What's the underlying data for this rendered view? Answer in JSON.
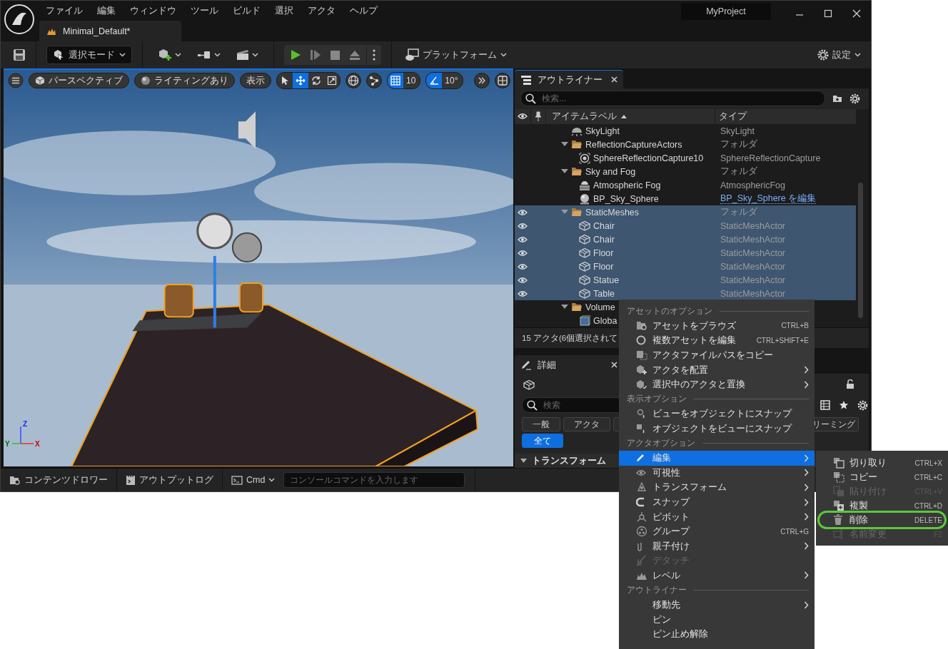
{
  "window": {
    "title": "MyProject",
    "menu": [
      "ファイル",
      "編集",
      "ウィンドウ",
      "ツール",
      "ビルド",
      "選択",
      "アクタ",
      "ヘルプ"
    ],
    "tab": "Minimal_Default*"
  },
  "toolbar": {
    "mode": "選択モード",
    "platform": "プラットフォーム",
    "settings": "設定"
  },
  "viewport": {
    "view": "パースペクティブ",
    "lighting": "ライティングあり",
    "show": "表示",
    "tools": [
      {
        "selected": false
      },
      {
        "selected": true
      },
      {
        "selected": false
      },
      {
        "selected": false
      }
    ],
    "grid": {
      "on": true,
      "value": "10"
    },
    "angle": {
      "on": true,
      "value": "10°"
    },
    "axes": [
      "Z",
      "Y",
      "X"
    ]
  },
  "outliner": {
    "title": "アウトライナー",
    "search": {
      "placeholder": "検索..."
    },
    "columns": [
      "アイテムラベル",
      "タイプ"
    ],
    "rows": [
      {
        "label": "SkyLight",
        "kind": "light",
        "type": "SkyLight",
        "type_link": false,
        "selected": false
      },
      {
        "label": "ReflectionCaptureActors",
        "kind": "folder",
        "expanded": true,
        "type": "フォルダ",
        "type_link": false,
        "selected": false,
        "children": [
          {
            "label": "SphereReflectionCapture10",
            "kind": "capture",
            "type": "SphereReflectionCapture",
            "type_link": false,
            "selected": false
          }
        ]
      },
      {
        "label": "Sky and Fog",
        "kind": "folder",
        "expanded": true,
        "type": "フォルダ",
        "type_link": false,
        "selected": false,
        "children": [
          {
            "label": "Atmospheric Fog",
            "kind": "fog",
            "type": "AtmosphericFog",
            "type_link": false,
            "selected": false
          },
          {
            "label": "BP_Sky_Sphere",
            "kind": "sky",
            "type": "BP_Sky_Sphere を編集",
            "type_link": true,
            "selected": false
          }
        ]
      },
      {
        "label": "StaticMeshes",
        "kind": "folder",
        "expanded": true,
        "type": "フォルダ",
        "type_link": false,
        "selected": true,
        "children": [
          {
            "label": "Chair",
            "kind": "mesh",
            "type": "StaticMeshActor",
            "type_link": false,
            "selected": true
          },
          {
            "label": "Chair",
            "kind": "mesh",
            "type": "StaticMeshActor",
            "type_link": false,
            "selected": true
          },
          {
            "label": "Floor",
            "kind": "mesh",
            "type": "StaticMeshActor",
            "type_link": false,
            "selected": true
          },
          {
            "label": "Floor",
            "kind": "mesh",
            "type": "StaticMeshActor",
            "type_link": false,
            "selected": true
          },
          {
            "label": "Statue",
            "kind": "mesh",
            "type": "StaticMeshActor",
            "type_link": false,
            "selected": true
          },
          {
            "label": "Table",
            "kind": "mesh",
            "type": "StaticMeshActor",
            "type_link": false,
            "selected": true
          }
        ]
      },
      {
        "label": "Volume",
        "kind": "folder",
        "expanded": true,
        "selected": false,
        "children": [
          {
            "label": "Globa",
            "kind": "volume",
            "selected": false
          }
        ]
      }
    ],
    "status": "15 アクタ(6個選択されて"
  },
  "details": {
    "title": "詳細",
    "search": {
      "placeholder": "検索"
    },
    "filters": [
      {
        "label": "一般",
        "selected": false
      },
      {
        "label": "アクタ",
        "selected": false
      },
      {
        "selected": false
      },
      {
        "label": "リーミング",
        "selected": false
      },
      {
        "label": "全て",
        "selected": true
      }
    ],
    "section": "トランスフォーム"
  },
  "bottom": {
    "content_drawer": "コンテンツドロワー",
    "output_log": "アウトプットログ",
    "cmd": "Cmd",
    "console_placeholder": "コンソールコマンドを入力します"
  },
  "context_menu": {
    "items": [
      {
        "kind": "section",
        "label": "アセットのオプション"
      },
      {
        "kind": "item",
        "label": "アセットをブラウズ",
        "shortcut": "CTRL+B",
        "submenu": false,
        "disabled": false,
        "selected": false
      },
      {
        "kind": "item",
        "label": "複数アセットを編集",
        "shortcut": "CTRL+SHIFT+E",
        "submenu": false,
        "disabled": false,
        "selected": false
      },
      {
        "kind": "item",
        "label": "アクタファイルパスをコピー",
        "submenu": false,
        "disabled": false,
        "selected": false
      },
      {
        "kind": "item",
        "label": "アクタを配置",
        "submenu": true,
        "disabled": false,
        "selected": false
      },
      {
        "kind": "item",
        "label": "選択中のアクタと置換",
        "submenu": true,
        "disabled": false,
        "selected": false
      },
      {
        "kind": "section",
        "label": "表示オプション"
      },
      {
        "kind": "item",
        "label": "ビューをオブジェクトにスナップ",
        "submenu": false,
        "disabled": false,
        "selected": false
      },
      {
        "kind": "item",
        "label": "オブジェクトをビューにスナップ",
        "submenu": false,
        "disabled": false,
        "selected": false
      },
      {
        "kind": "section",
        "label": "アクタオプション"
      },
      {
        "kind": "item",
        "label": "編集",
        "submenu": true,
        "disabled": false,
        "selected": true
      },
      {
        "kind": "item",
        "label": "可視性",
        "submenu": true,
        "disabled": false,
        "selected": false
      },
      {
        "kind": "item",
        "label": "トランスフォーム",
        "submenu": true,
        "disabled": false,
        "selected": false
      },
      {
        "kind": "item",
        "label": "スナップ",
        "submenu": true,
        "disabled": false,
        "selected": false
      },
      {
        "kind": "item",
        "label": "ピボット",
        "submenu": true,
        "disabled": false,
        "selected": false
      },
      {
        "kind": "item",
        "label": "グループ",
        "shortcut": "CTRL+G",
        "submenu": false,
        "disabled": false,
        "selected": false
      },
      {
        "kind": "item",
        "label": "親子付け",
        "submenu": true,
        "disabled": false,
        "selected": false
      },
      {
        "kind": "item",
        "label": "デタッチ",
        "submenu": false,
        "disabled": true,
        "selected": false
      },
      {
        "kind": "item",
        "label": "レベル",
        "submenu": true,
        "disabled": false,
        "selected": false
      },
      {
        "kind": "section",
        "label": "アウトライナー"
      },
      {
        "kind": "item",
        "label": "移動先",
        "submenu": true,
        "disabled": false,
        "selected": false
      },
      {
        "kind": "item",
        "label": "ピン",
        "submenu": false,
        "disabled": false,
        "selected": false
      },
      {
        "kind": "item",
        "label": "ピン止め解除",
        "submenu": false,
        "disabled": false,
        "selected": false
      }
    ]
  },
  "submenu": {
    "items": [
      {
        "label": "切り取り",
        "shortcut": "CTRL+X",
        "disabled": false,
        "highlighted": false
      },
      {
        "label": "コピー",
        "shortcut": "CTRL+C",
        "disabled": false,
        "highlighted": false
      },
      {
        "label": "貼り付け",
        "shortcut": "CTRL+V",
        "disabled": true,
        "highlighted": false
      },
      {
        "label": "複製",
        "shortcut": "CTRL+D",
        "disabled": false,
        "highlighted": false
      },
      {
        "label": "削除",
        "shortcut": "DELETE",
        "disabled": false,
        "highlighted": true
      },
      {
        "label": "名前変更",
        "shortcut": "F2",
        "disabled": true,
        "highlighted": false
      }
    ]
  }
}
